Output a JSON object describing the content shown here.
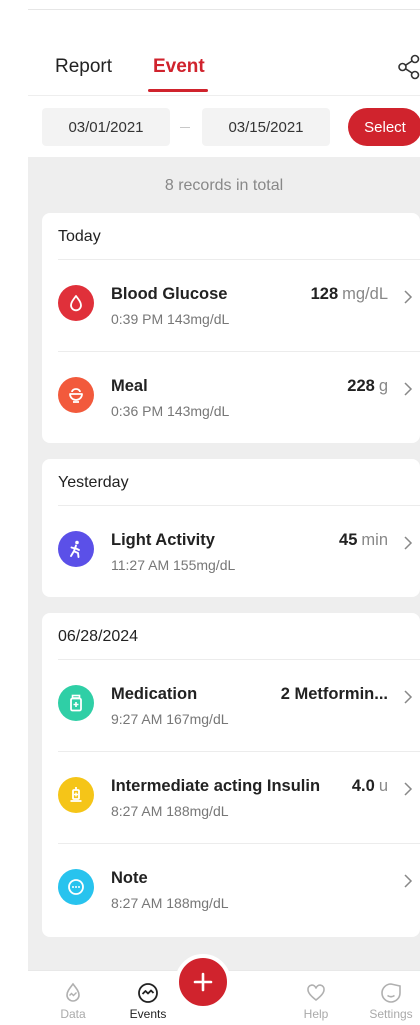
{
  "tabs": {
    "report": "Report",
    "event": "Event",
    "active": "Event"
  },
  "date_range": {
    "from": "03/01/2021",
    "to": "03/15/2021",
    "select_label": "Select"
  },
  "summary": "8 records in total",
  "groups": [
    {
      "title": "Today",
      "events": [
        {
          "name": "Blood Glucose",
          "sub": "0:39 PM 143mg/dL",
          "value": "128",
          "unit": "mg/dL",
          "icon": "blood-drop-icon",
          "color": "#e0303a"
        },
        {
          "name": "Meal",
          "sub": "0:36 PM 143mg/dL",
          "value": "228",
          "unit": "g",
          "icon": "meal-bowl-icon",
          "color": "#f25a3c"
        }
      ]
    },
    {
      "title": "Yesterday",
      "events": [
        {
          "name": "Light Activity",
          "sub": "11:27 AM 155mg/dL",
          "value": "45",
          "unit": "min",
          "icon": "walking-person-icon",
          "color": "#5b50e8"
        }
      ]
    },
    {
      "title": "06/28/2024",
      "events": [
        {
          "name": "Medication",
          "sub": "9:27 AM 167mg/dL",
          "value": "2 Metformin...",
          "unit": "",
          "icon": "pill-bottle-icon",
          "color": "#2fcfa6"
        },
        {
          "name": "Intermediate acting Insulin",
          "sub": "8:27 AM 188mg/dL",
          "value": "4.0",
          "unit": "u",
          "icon": "insulin-pen-icon",
          "color": "#f5c518"
        },
        {
          "name": "Note",
          "sub": "8:27 AM 188mg/dL",
          "value": "",
          "unit": "",
          "icon": "note-bubble-icon",
          "color": "#28c3ee"
        }
      ]
    }
  ],
  "nav": {
    "data": "Data",
    "events": "Events",
    "help": "Help",
    "settings": "Settings",
    "add_icon": "plus-icon"
  },
  "colors": {
    "accent": "#d0232d",
    "background": "#eeeeee"
  }
}
